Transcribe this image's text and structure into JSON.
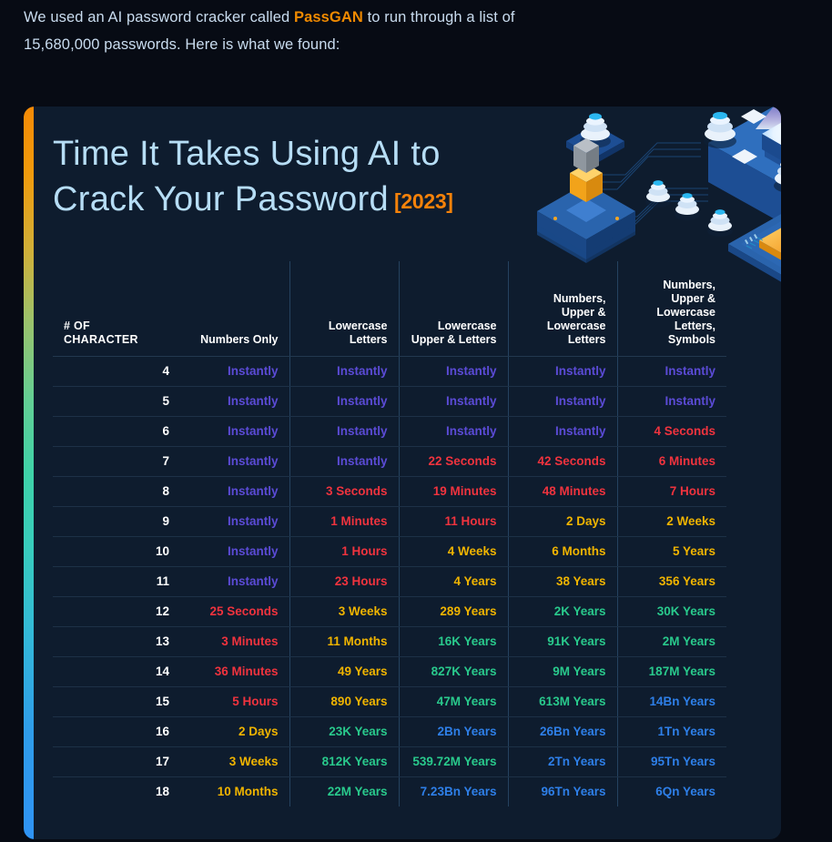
{
  "intro": {
    "before": "We used an AI password cracker called ",
    "brand": "PassGAN",
    "after": " to run through a list of 15,680,000 passwords. Here is what we found:"
  },
  "card": {
    "title_line1": "Time It Takes Using AI to",
    "title_line2": "Crack Your Password",
    "year": "[2023]",
    "accent_orange": "#f5820a",
    "heading_color": "#b6ddf5",
    "background": "#0e1c2e",
    "gradient_bar": [
      "#f58a06",
      "#cfb03a",
      "#3fd2a8",
      "#33b9d8",
      "#2f93f5"
    ],
    "illustration": "isometric-server-platform-illustration"
  },
  "legend_colors": {
    "instantly": "#5b4bd6",
    "seconds_to_hours": "#f0333e",
    "days_to_years": "#f0b400",
    "thousands_of_years": "#29c98c",
    "billions_of_years": "#2e7fe8"
  },
  "chart_data": {
    "type": "table",
    "title": "Time It Takes Using AI to Crack Your Password [2023]",
    "columns": [
      "# OF CHARACTER",
      "Numbers Only",
      "Lowercase Letters",
      "Lowercase Upper & Letters",
      "Numbers, Upper & Lowercase Letters",
      "Numbers, Upper & Lowercase Letters, Symbols"
    ],
    "column_labels_multiline": [
      [
        "# OF",
        "CHARACTER"
      ],
      [
        "Numbers Only"
      ],
      [
        "Lowercase",
        "Letters"
      ],
      [
        "Lowercase",
        "Upper & Letters"
      ],
      [
        "Numbers,",
        "Upper &",
        "Lowercase",
        "Letters"
      ],
      [
        "Numbers,",
        "Upper &",
        "Lowercase",
        "Letters,",
        "Symbols"
      ]
    ],
    "rows": [
      {
        "chars": "4",
        "cells": [
          {
            "text": "Instantly",
            "color": "instant"
          },
          {
            "text": "Instantly",
            "color": "instant"
          },
          {
            "text": "Instantly",
            "color": "instant"
          },
          {
            "text": "Instantly",
            "color": "instant"
          },
          {
            "text": "Instantly",
            "color": "instant"
          }
        ]
      },
      {
        "chars": "5",
        "cells": [
          {
            "text": "Instantly",
            "color": "instant"
          },
          {
            "text": "Instantly",
            "color": "instant"
          },
          {
            "text": "Instantly",
            "color": "instant"
          },
          {
            "text": "Instantly",
            "color": "instant"
          },
          {
            "text": "Instantly",
            "color": "instant"
          }
        ]
      },
      {
        "chars": "6",
        "cells": [
          {
            "text": "Instantly",
            "color": "instant"
          },
          {
            "text": "Instantly",
            "color": "instant"
          },
          {
            "text": "Instantly",
            "color": "instant"
          },
          {
            "text": "Instantly",
            "color": "instant"
          },
          {
            "text": "4 Seconds",
            "color": "red"
          }
        ]
      },
      {
        "chars": "7",
        "cells": [
          {
            "text": "Instantly",
            "color": "instant"
          },
          {
            "text": "Instantly",
            "color": "instant"
          },
          {
            "text": "22 Seconds",
            "color": "red"
          },
          {
            "text": "42 Seconds",
            "color": "red"
          },
          {
            "text": "6 Minutes",
            "color": "red"
          }
        ]
      },
      {
        "chars": "8",
        "cells": [
          {
            "text": "Instantly",
            "color": "instant"
          },
          {
            "text": "3 Seconds",
            "color": "red"
          },
          {
            "text": "19 Minutes",
            "color": "red"
          },
          {
            "text": "48 Minutes",
            "color": "red"
          },
          {
            "text": "7 Hours",
            "color": "red"
          }
        ]
      },
      {
        "chars": "9",
        "cells": [
          {
            "text": "Instantly",
            "color": "instant"
          },
          {
            "text": "1 Minutes",
            "color": "red"
          },
          {
            "text": "11 Hours",
            "color": "red"
          },
          {
            "text": "2 Days",
            "color": "amber"
          },
          {
            "text": "2 Weeks",
            "color": "amber"
          }
        ]
      },
      {
        "chars": "10",
        "cells": [
          {
            "text": "Instantly",
            "color": "instant"
          },
          {
            "text": "1 Hours",
            "color": "red"
          },
          {
            "text": "4 Weeks",
            "color": "amber"
          },
          {
            "text": "6 Months",
            "color": "amber"
          },
          {
            "text": "5 Years",
            "color": "amber"
          }
        ]
      },
      {
        "chars": "11",
        "cells": [
          {
            "text": "Instantly",
            "color": "instant"
          },
          {
            "text": "23 Hours",
            "color": "red"
          },
          {
            "text": "4 Years",
            "color": "amber"
          },
          {
            "text": "38 Years",
            "color": "amber"
          },
          {
            "text": "356 Years",
            "color": "amber"
          }
        ]
      },
      {
        "chars": "12",
        "cells": [
          {
            "text": "25 Seconds",
            "color": "red"
          },
          {
            "text": "3 Weeks",
            "color": "amber"
          },
          {
            "text": "289 Years",
            "color": "amber"
          },
          {
            "text": "2K Years",
            "color": "green"
          },
          {
            "text": "30K Years",
            "color": "green"
          }
        ]
      },
      {
        "chars": "13",
        "cells": [
          {
            "text": "3 Minutes",
            "color": "red"
          },
          {
            "text": "11 Months",
            "color": "amber"
          },
          {
            "text": "16K Years",
            "color": "green"
          },
          {
            "text": "91K Years",
            "color": "green"
          },
          {
            "text": "2M Years",
            "color": "green"
          }
        ]
      },
      {
        "chars": "14",
        "cells": [
          {
            "text": "36 Minutes",
            "color": "red"
          },
          {
            "text": "49 Years",
            "color": "amber"
          },
          {
            "text": "827K Years",
            "color": "green"
          },
          {
            "text": "9M Years",
            "color": "green"
          },
          {
            "text": "187M Years",
            "color": "green"
          }
        ]
      },
      {
        "chars": "15",
        "cells": [
          {
            "text": "5 Hours",
            "color": "red"
          },
          {
            "text": "890 Years",
            "color": "amber"
          },
          {
            "text": "47M Years",
            "color": "green"
          },
          {
            "text": "613M Years",
            "color": "green"
          },
          {
            "text": "14Bn Years",
            "color": "blue"
          }
        ]
      },
      {
        "chars": "16",
        "cells": [
          {
            "text": "2 Days",
            "color": "amber"
          },
          {
            "text": "23K Years",
            "color": "green"
          },
          {
            "text": "2Bn Years",
            "color": "blue"
          },
          {
            "text": "26Bn Years",
            "color": "blue"
          },
          {
            "text": "1Tn Years",
            "color": "blue"
          }
        ]
      },
      {
        "chars": "17",
        "cells": [
          {
            "text": "3 Weeks",
            "color": "amber"
          },
          {
            "text": "812K Years",
            "color": "green"
          },
          {
            "text": "539.72M Years",
            "color": "green"
          },
          {
            "text": "2Tn Years",
            "color": "blue"
          },
          {
            "text": "95Tn Years",
            "color": "blue"
          }
        ]
      },
      {
        "chars": "18",
        "cells": [
          {
            "text": "10 Months",
            "color": "amber"
          },
          {
            "text": "22M Years",
            "color": "green"
          },
          {
            "text": "7.23Bn Years",
            "color": "blue"
          },
          {
            "text": "96Tn Years",
            "color": "blue"
          },
          {
            "text": "6Qn Years",
            "color": "blue"
          }
        ]
      }
    ]
  }
}
